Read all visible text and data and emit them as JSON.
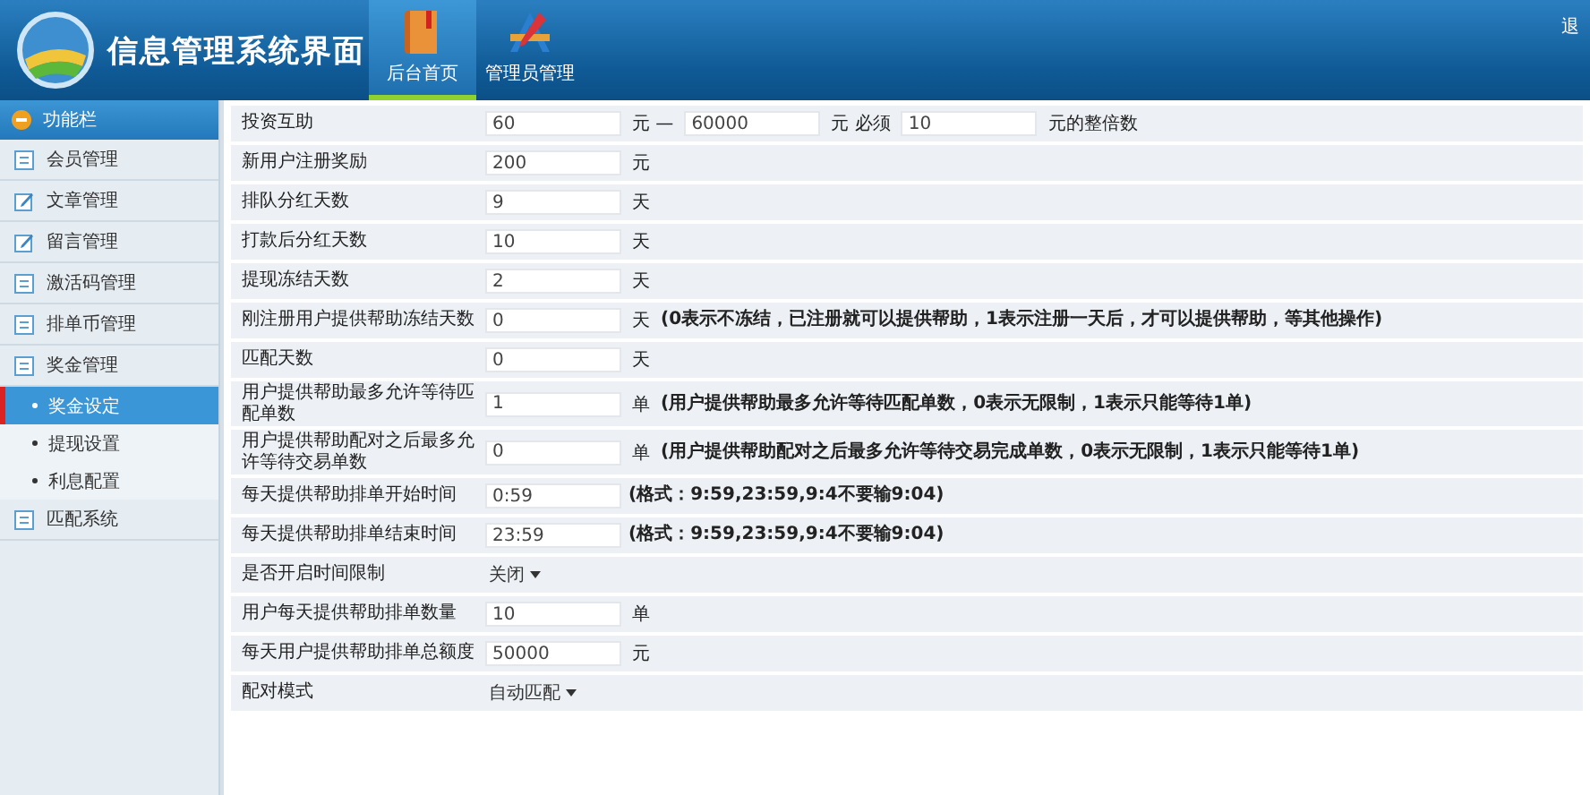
{
  "header": {
    "title": "信息管理系统界面",
    "tabs": [
      {
        "label": "后台首页",
        "selected": true
      },
      {
        "label": "管理员管理",
        "selected": false
      }
    ],
    "logout": "退"
  },
  "sidebar": {
    "title": "功能栏",
    "items": [
      {
        "label": "会员管理",
        "kind": "list"
      },
      {
        "label": "文章管理",
        "kind": "edit"
      },
      {
        "label": "留言管理",
        "kind": "edit"
      },
      {
        "label": "激活码管理",
        "kind": "list"
      },
      {
        "label": "排单币管理",
        "kind": "list"
      },
      {
        "label": "奖金管理",
        "kind": "list",
        "expanded": true,
        "children": [
          {
            "label": "奖金设定",
            "selected": true
          },
          {
            "label": "提现设置",
            "selected": false
          },
          {
            "label": "利息配置",
            "selected": false
          }
        ]
      },
      {
        "label": "匹配系统",
        "kind": "list"
      }
    ]
  },
  "form": {
    "rows": [
      {
        "label": "投资互助",
        "parts": [
          {
            "kind": "input",
            "value": "60"
          },
          {
            "kind": "text",
            "text": "元 —"
          },
          {
            "kind": "input",
            "value": "60000"
          },
          {
            "kind": "text",
            "text": "元 必须"
          },
          {
            "kind": "input",
            "value": "10"
          },
          {
            "kind": "text",
            "text": "元的整倍数"
          }
        ]
      },
      {
        "label": "新用户注册奖励",
        "parts": [
          {
            "kind": "input",
            "value": "200"
          },
          {
            "kind": "text",
            "text": "元"
          }
        ]
      },
      {
        "label": "排队分红天数",
        "parts": [
          {
            "kind": "input",
            "value": "9"
          },
          {
            "kind": "text",
            "text": "天"
          }
        ]
      },
      {
        "label": "打款后分红天数",
        "parts": [
          {
            "kind": "input",
            "value": "10"
          },
          {
            "kind": "text",
            "text": "天"
          }
        ]
      },
      {
        "label": "提现冻结天数",
        "parts": [
          {
            "kind": "input",
            "value": "2"
          },
          {
            "kind": "text",
            "text": "天"
          }
        ]
      },
      {
        "label": "刚注册用户提供帮助冻结天数",
        "parts": [
          {
            "kind": "input",
            "value": "0"
          },
          {
            "kind": "text",
            "text": "天"
          },
          {
            "kind": "note",
            "text": "(0表示不冻结，已注册就可以提供帮助，1表示注册一天后，才可以提供帮助，等其他操作)"
          }
        ]
      },
      {
        "label": "匹配天数",
        "parts": [
          {
            "kind": "input",
            "value": "0"
          },
          {
            "kind": "text",
            "text": "天"
          }
        ]
      },
      {
        "label": "用户提供帮助最多允许等待匹配单数",
        "parts": [
          {
            "kind": "input",
            "value": "1"
          },
          {
            "kind": "text",
            "text": "单"
          },
          {
            "kind": "note",
            "text": "(用户提供帮助最多允许等待匹配单数，0表示无限制，1表示只能等待1单)"
          }
        ]
      },
      {
        "label": "用户提供帮助配对之后最多允许等待交易单数",
        "parts": [
          {
            "kind": "input",
            "value": "0"
          },
          {
            "kind": "text",
            "text": "单"
          },
          {
            "kind": "note",
            "text": "(用户提供帮助配对之后最多允许等待交易完成单数，0表示无限制，1表示只能等待1单)"
          }
        ]
      },
      {
        "label": "每天提供帮助排单开始时间",
        "parts": [
          {
            "kind": "input",
            "value": "0:59"
          },
          {
            "kind": "note",
            "text": "(格式：9:59,23:59,9:4不要输9:04)"
          }
        ]
      },
      {
        "label": "每天提供帮助排单结束时间",
        "parts": [
          {
            "kind": "input",
            "value": "23:59"
          },
          {
            "kind": "note",
            "text": "(格式：9:59,23:59,9:4不要输9:04)"
          }
        ]
      },
      {
        "label": "是否开启时间限制",
        "parts": [
          {
            "kind": "select",
            "value": "关闭"
          }
        ]
      },
      {
        "label": "用户每天提供帮助排单数量",
        "parts": [
          {
            "kind": "input",
            "value": "10"
          },
          {
            "kind": "text",
            "text": "单"
          }
        ]
      },
      {
        "label": "每天用户提供帮助排单总额度",
        "parts": [
          {
            "kind": "input",
            "value": "50000"
          },
          {
            "kind": "text",
            "text": "元"
          }
        ]
      },
      {
        "label": "配对模式",
        "parts": [
          {
            "kind": "select",
            "value": "自动匹配"
          }
        ]
      }
    ]
  }
}
